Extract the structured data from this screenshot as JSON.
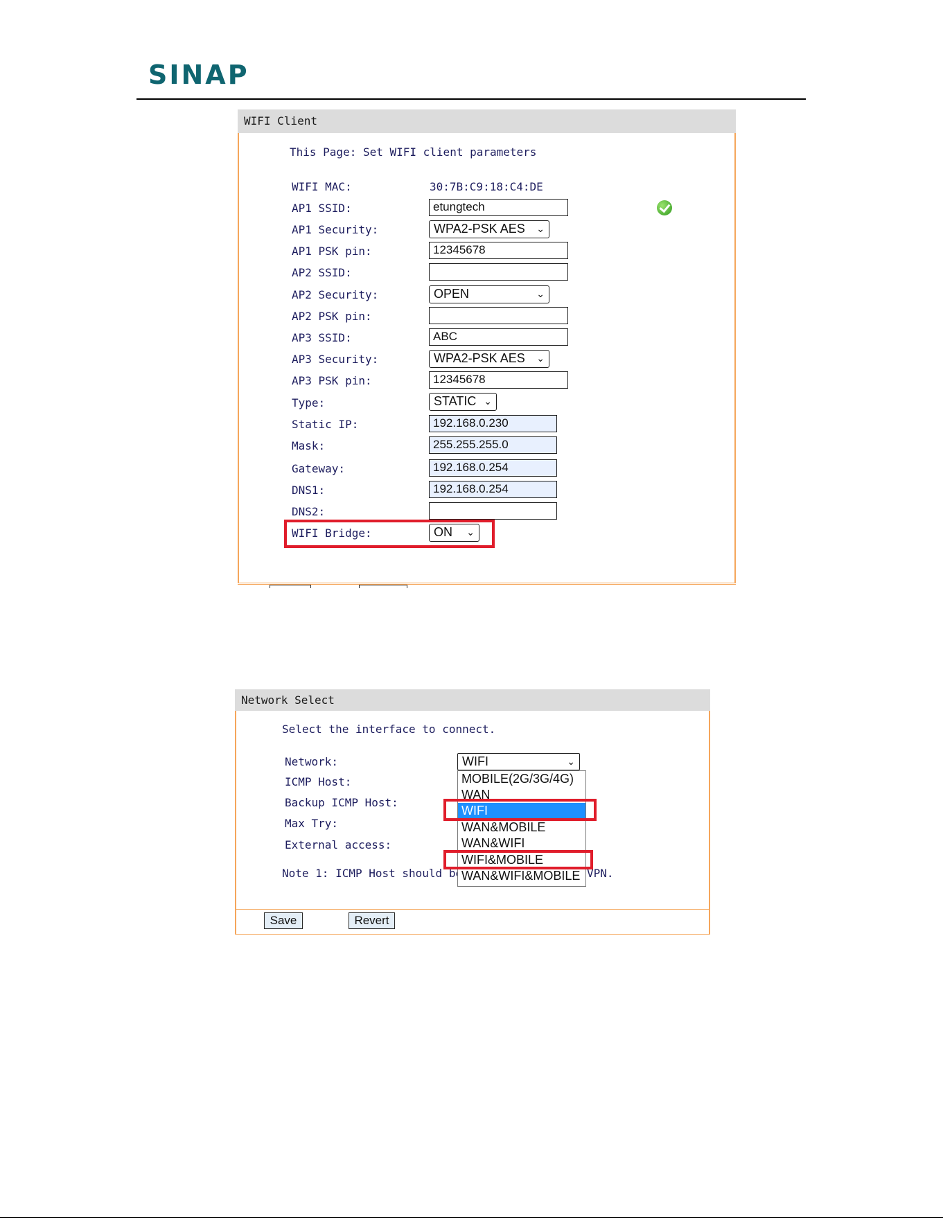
{
  "brand": {
    "logo": "SINAP"
  },
  "wifi_client": {
    "title": "WIFI Client",
    "intro": "This Page: Set WIFI client parameters",
    "fields": {
      "wifi_mac": {
        "label": "WIFI MAC:",
        "value": "30:7B:C9:18:C4:DE"
      },
      "ap1_ssid": {
        "label": "AP1 SSID:",
        "value": "etungtech"
      },
      "ap1_security": {
        "label": "AP1 Security:",
        "value": "WPA2-PSK AES"
      },
      "ap1_psk": {
        "label": "AP1 PSK pin:",
        "value": "12345678"
      },
      "ap2_ssid": {
        "label": "AP2 SSID:",
        "value": ""
      },
      "ap2_security": {
        "label": "AP2 Security:",
        "value": "OPEN"
      },
      "ap2_psk": {
        "label": "AP2 PSK pin:",
        "value": ""
      },
      "ap3_ssid": {
        "label": "AP3 SSID:",
        "value": "ABC"
      },
      "ap3_security": {
        "label": "AP3 Security:",
        "value": "WPA2-PSK AES"
      },
      "ap3_psk": {
        "label": "AP3 PSK pin:",
        "value": "12345678"
      },
      "type": {
        "label": "Type:",
        "value": "STATIC"
      },
      "static_ip": {
        "label": "Static IP:",
        "value": "192.168.0.230"
      },
      "mask": {
        "label": "Mask:",
        "value": "255.255.255.0"
      },
      "gateway": {
        "label": "Gateway:",
        "value": "192.168.0.254"
      },
      "dns1": {
        "label": "DNS1:",
        "value": "192.168.0.254"
      },
      "dns2": {
        "label": "DNS2:",
        "value": ""
      },
      "wifi_bridge": {
        "label": "WIFI Bridge:",
        "value": "ON"
      }
    },
    "status_icon": "check-circle-icon"
  },
  "network_select": {
    "title": "Network Select",
    "intro": "Select the interface to connect.",
    "labels": {
      "network": "Network:",
      "icmp_host": "ICMP Host:",
      "backup_icmp": "Backup ICMP Host:",
      "max_try": "Max Try:",
      "external": "External access:"
    },
    "network_value": "WIFI",
    "options": [
      "MOBILE(2G/3G/4G)",
      "WAN",
      "WIFI",
      "WAN&MOBILE",
      "WAN&WIFI",
      "WIFI&MOBILE",
      "WAN&WIFI&MOBILE"
    ],
    "note_left": "Note 1: ICMP Host should be s",
    "note_right": "VPN.",
    "save_label": "Save",
    "revert_label": "Revert"
  },
  "colors": {
    "accent_border": "#f5a65b",
    "highlight_box": "#e01d2b",
    "logo": "#0f6570",
    "selected_option": "#1e90ff"
  }
}
